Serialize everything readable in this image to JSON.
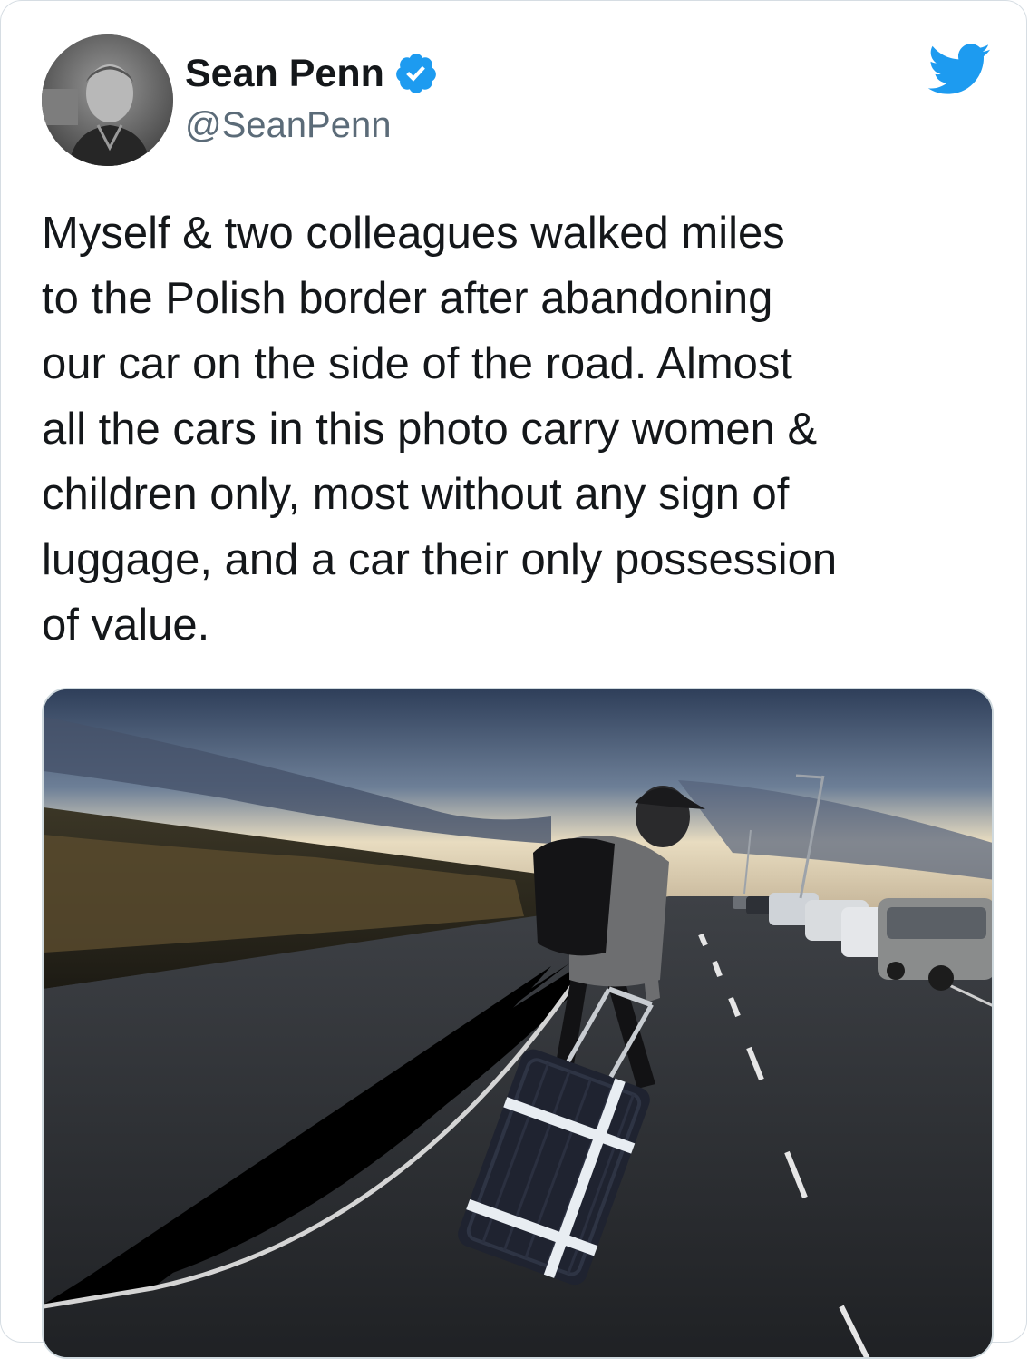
{
  "tweet": {
    "author": {
      "display_name": "Sean Penn",
      "handle": "@SeanPenn",
      "verified": true,
      "avatar_icon": "profile-photo"
    },
    "text": "Myself & two colleagues walked miles\nto the Polish border after abandoning\nour car on the side of the road. Almost\nall the cars in this photo carry women &\nchildren only, most without any sign of\nluggage, and a car their only possession\nof value.",
    "media": {
      "type": "photo",
      "subject": "man with backpack pulling suitcase along road beside line of parked cars at dusk"
    },
    "platform_icon": "twitter-bird-icon"
  },
  "colors": {
    "text_primary": "#14171a",
    "text_secondary": "#5b6b78",
    "brand_blue": "#1d9bf0",
    "border": "#d6dde3"
  }
}
